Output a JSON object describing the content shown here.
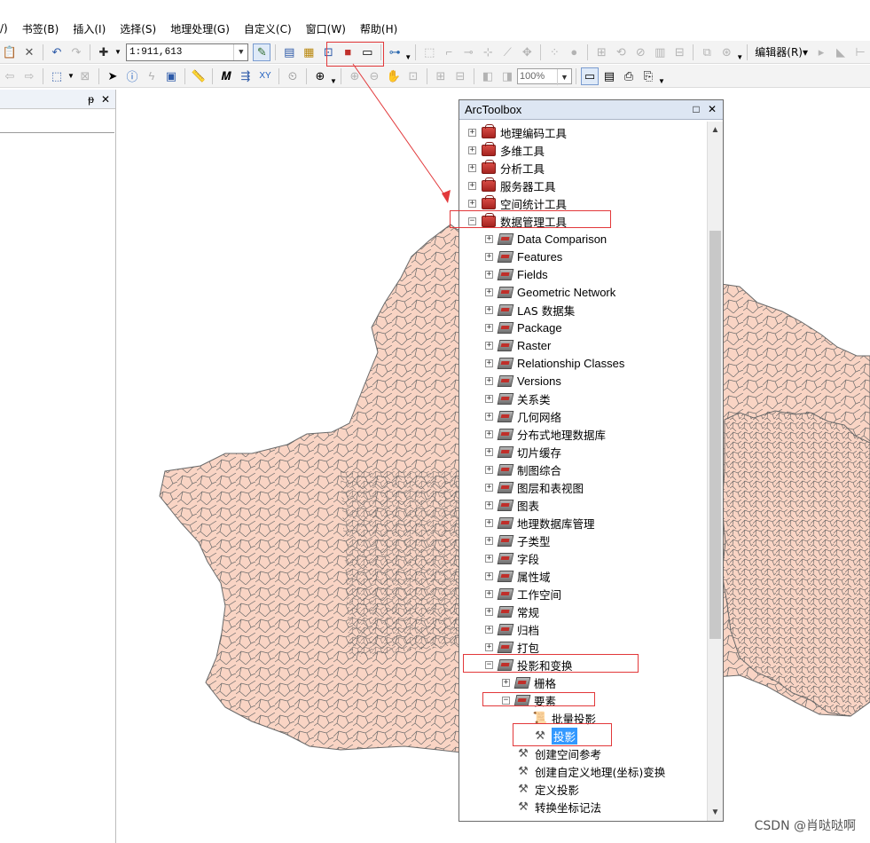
{
  "menu": {
    "items": [
      "/)",
      "书签(B)",
      "插入(I)",
      "选择(S)",
      "地理处理(G)",
      "自定义(C)",
      "窗口(W)",
      "帮助(H)"
    ]
  },
  "toolbar1": {
    "scale_value": "1:911,613",
    "editor_label": "编辑器(R)",
    "editor_dropdown": "▾"
  },
  "toolbar2": {
    "zoom_value": "100%"
  },
  "toc": {
    "pin_glyph": "ᵽ",
    "close_glyph": "✕"
  },
  "arctoolbox": {
    "title": "ArcToolbox",
    "restore_glyph": "□",
    "close_glyph": "✕",
    "items": [
      {
        "label": "地理编码工具",
        "exp": "+"
      },
      {
        "label": "多维工具",
        "exp": "+"
      },
      {
        "label": "分析工具",
        "exp": "+"
      },
      {
        "label": "服务器工具",
        "exp": "+"
      },
      {
        "label": "空间统计工具",
        "exp": "+"
      },
      {
        "label": "数据管理工具",
        "exp": "−"
      },
      {
        "label": "Data Comparison",
        "exp": "+"
      },
      {
        "label": "Features",
        "exp": "+"
      },
      {
        "label": "Fields",
        "exp": "+"
      },
      {
        "label": "Geometric Network",
        "exp": "+"
      },
      {
        "label": "LAS 数据集",
        "exp": "+"
      },
      {
        "label": "Package",
        "exp": "+"
      },
      {
        "label": "Raster",
        "exp": "+"
      },
      {
        "label": "Relationship Classes",
        "exp": "+"
      },
      {
        "label": "Versions",
        "exp": "+"
      },
      {
        "label": "关系类",
        "exp": "+"
      },
      {
        "label": "几何网络",
        "exp": "+"
      },
      {
        "label": "分布式地理数据库",
        "exp": "+"
      },
      {
        "label": "切片缓存",
        "exp": "+"
      },
      {
        "label": "制图综合",
        "exp": "+"
      },
      {
        "label": "图层和表视图",
        "exp": "+"
      },
      {
        "label": "图表",
        "exp": "+"
      },
      {
        "label": "地理数据库管理",
        "exp": "+"
      },
      {
        "label": "子类型",
        "exp": "+"
      },
      {
        "label": "字段",
        "exp": "+"
      },
      {
        "label": "属性域",
        "exp": "+"
      },
      {
        "label": "工作空间",
        "exp": "+"
      },
      {
        "label": "常规",
        "exp": "+"
      },
      {
        "label": "归档",
        "exp": "+"
      },
      {
        "label": "打包",
        "exp": "+"
      },
      {
        "label": "投影和变换",
        "exp": "−"
      },
      {
        "label": "栅格",
        "exp": "+"
      },
      {
        "label": "要素",
        "exp": "−"
      },
      {
        "label": "批量投影"
      },
      {
        "label": "投影"
      },
      {
        "label": "创建空间参考"
      },
      {
        "label": "创建自定义地理(坐标)变换"
      },
      {
        "label": "定义投影"
      },
      {
        "label": "转换坐标记法"
      }
    ]
  },
  "watermark": "CSDN @肖哒哒啊",
  "colors": {
    "map_fill": "#f9d4c4",
    "map_stroke": "#6a6a6a",
    "annotation": "#e2383a",
    "selection": "#3399ff"
  }
}
